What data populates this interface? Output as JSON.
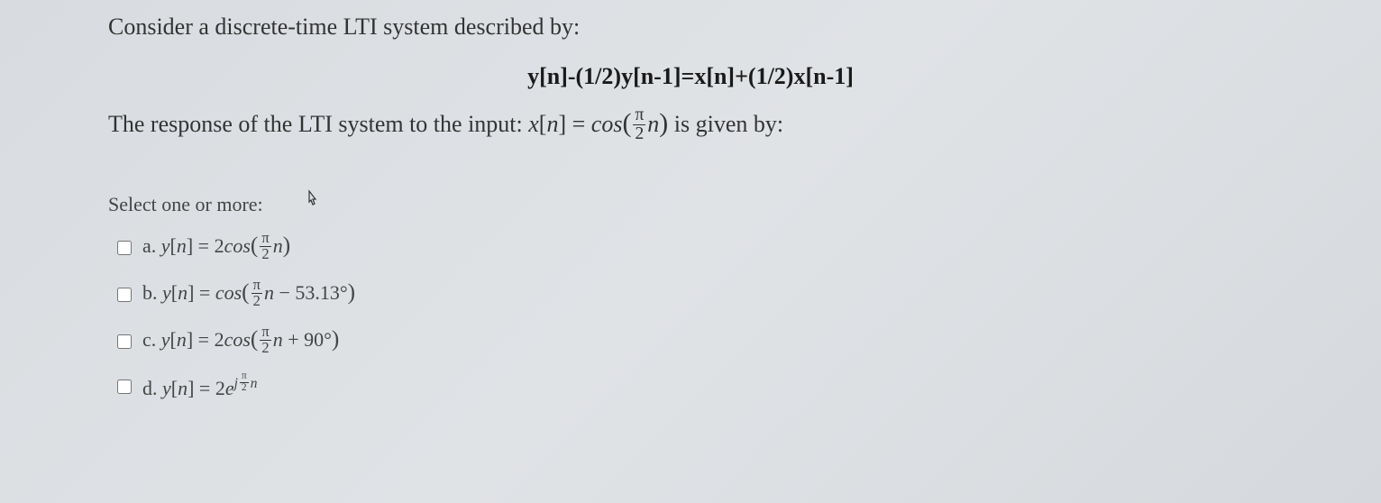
{
  "question": {
    "intro": "Consider a discrete-time LTI system described by:",
    "equation": "y[n]-(1/2)y[n-1]=x[n]+(1/2)x[n-1]",
    "line2_prefix": "The response of the LTI system to the input: ",
    "line2_input": "x[n] = cos(π/2 n)",
    "line2_suffix": " is given by:"
  },
  "select_label": "Select one or more:",
  "options": {
    "a": {
      "letter": "a.",
      "expr": "y[n] = 2cos(π/2 n)"
    },
    "b": {
      "letter": "b.",
      "expr": "y[n] = cos(π/2 n − 53.13°)"
    },
    "c": {
      "letter": "c.",
      "expr": "y[n] = 2cos(π/2 n + 90°)"
    },
    "d": {
      "letter": "d.",
      "expr": "y[n] = 2e^{jπ/2 n}"
    }
  }
}
